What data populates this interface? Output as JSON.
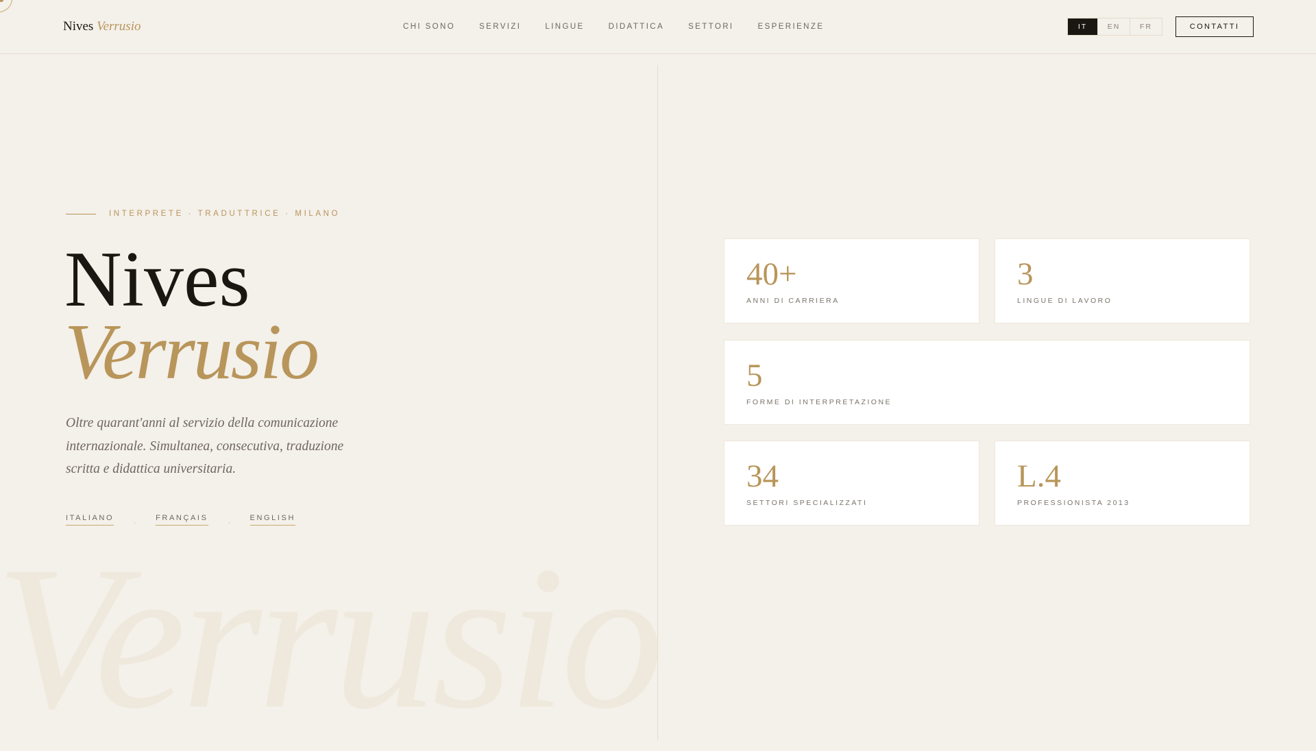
{
  "header": {
    "logo_first": "Nives",
    "logo_second": "Verrusio",
    "nav": [
      "CHI SONO",
      "SERVIZI",
      "LINGUE",
      "DIDATTICA",
      "SETTORI",
      "ESPERIENZE"
    ],
    "languages": [
      "IT",
      "EN",
      "FR"
    ],
    "active_language": "IT",
    "contact_label": "CONTATTI"
  },
  "hero": {
    "tagline": "INTERPRETE · TRADUTTRICE · MILANO",
    "first_name": "Nives",
    "last_name": "Verrusio",
    "description": "Oltre quarant'anni al servizio della comunicazione internazionale. Simultanea, consecutiva, traduzione scritta e didattica universitaria.",
    "language_links": [
      "ITALIANO",
      "FRANÇAIS",
      "ENGLISH"
    ],
    "watermark": "Verrusio"
  },
  "stats": [
    {
      "value": "40+",
      "label": "ANNI DI CARRIERA"
    },
    {
      "value": "3",
      "label": "LINGUE DI LAVORO"
    },
    {
      "value": "5",
      "label": "FORME DI INTERPRETAZIONE"
    },
    {
      "value": "34",
      "label": "SETTORI SPECIALIZZATI"
    },
    {
      "value": "L.4",
      "label": "PROFESSIONISTA 2013"
    }
  ],
  "colors": {
    "accent": "#b8955a",
    "dark": "#1a1712",
    "background": "#f4f0ea"
  }
}
